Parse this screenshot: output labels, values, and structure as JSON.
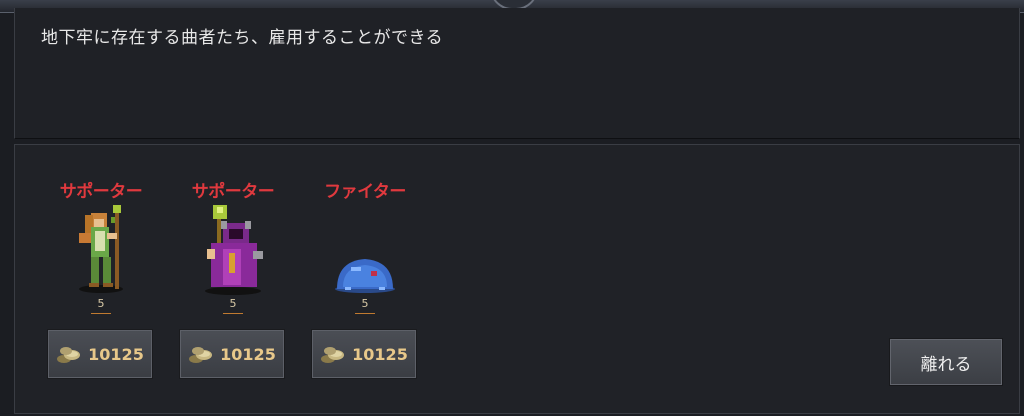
{
  "description": "地下牢に存在する曲者たち、雇用することができる",
  "units": [
    {
      "type": "サポーター",
      "level": "5",
      "cost": "10125",
      "sprite_icon": "green-dryad-staff-icon"
    },
    {
      "type": "サポーター",
      "level": "5",
      "cost": "10125",
      "sprite_icon": "purple-robed-mage-icon"
    },
    {
      "type": "ファイター",
      "level": "5",
      "cost": "10125",
      "sprite_icon": "blue-slime-icon"
    }
  ],
  "coin_icon": "coin-bag-icon",
  "leave_label": "離れる",
  "colors": {
    "unit_type_red": "#e0393e",
    "cost_gold": "#e8c88a",
    "panel_bg": "#202227"
  }
}
